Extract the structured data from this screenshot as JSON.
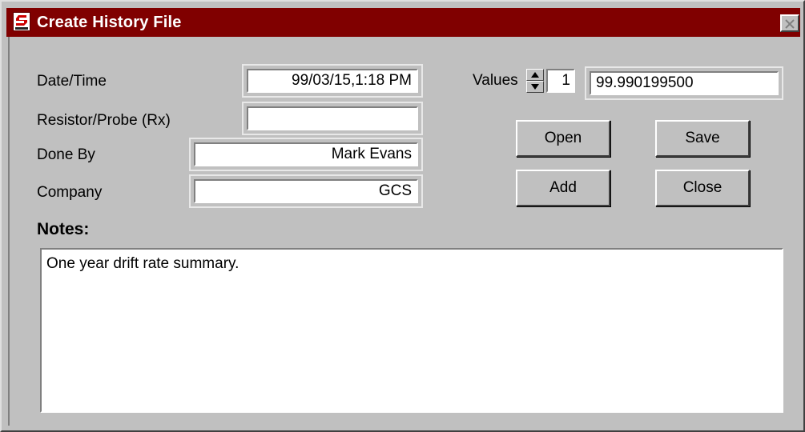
{
  "window": {
    "title": "Create History File",
    "icon": "app-logo-icon",
    "close_icon": "close-icon"
  },
  "form": {
    "date_time_label": "Date/Time",
    "date_time_value": "99/03/15,1:18 PM",
    "resistor_label": "Resistor/Probe (Rx)",
    "resistor_value": "",
    "done_by_label": "Done By",
    "done_by_value": "Mark Evans",
    "company_label": "Company",
    "company_value": "GCS"
  },
  "values": {
    "label": "Values",
    "index": "1",
    "value": "99.990199500"
  },
  "buttons": {
    "open": "Open",
    "save": "Save",
    "add": "Add",
    "close": "Close"
  },
  "notes": {
    "label": "Notes:",
    "text": "One year drift rate summary."
  },
  "colors": {
    "titlebar": "#800000",
    "face": "#c0c0c0"
  }
}
